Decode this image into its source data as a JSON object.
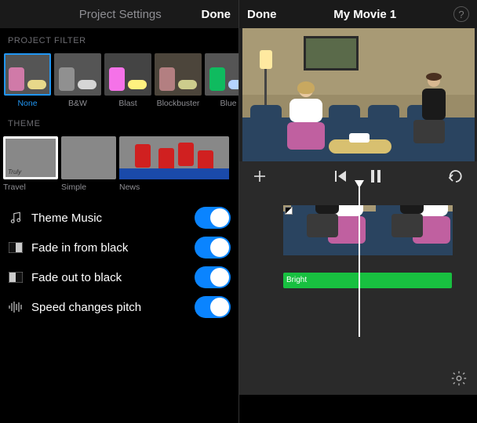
{
  "left": {
    "nav": {
      "title": "Project Settings",
      "done": "Done"
    },
    "sections": {
      "filter_header": "PROJECT FILTER",
      "theme_header": "THEME"
    },
    "filters": [
      {
        "label": "None",
        "selected": true
      },
      {
        "label": "B&W"
      },
      {
        "label": "Blast"
      },
      {
        "label": "Blockbuster"
      },
      {
        "label": "Blue"
      }
    ],
    "themes": [
      {
        "label": "Travel"
      },
      {
        "label": "Simple"
      },
      {
        "label": "News",
        "badge": "News"
      }
    ],
    "settings": [
      {
        "icon": "music-note-icon",
        "label": "Theme Music",
        "on": true
      },
      {
        "icon": "fade-in-icon",
        "label": "Fade in from black",
        "on": true
      },
      {
        "icon": "fade-out-icon",
        "label": "Fade out to black",
        "on": true
      },
      {
        "icon": "waveform-icon",
        "label": "Speed changes pitch",
        "on": true
      }
    ]
  },
  "right": {
    "nav": {
      "done": "Done",
      "title": "My Movie 1"
    },
    "timeline": {
      "audio_label": "Bright"
    }
  },
  "colors": {
    "accent": "#0a84ff",
    "filter_selected": "#2196f3",
    "audio": "#18c040"
  }
}
